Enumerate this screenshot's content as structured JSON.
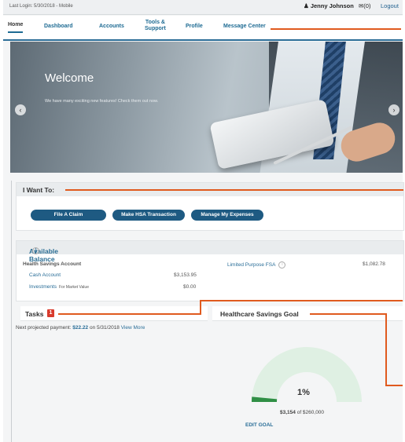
{
  "topbar": {
    "last_login": "Last Login: 5/30/2018 - Mobile",
    "user": "Jenny Johnson",
    "messages": "(0)",
    "logout": "Logout"
  },
  "nav": {
    "tabs": [
      "Home",
      "Dashboard",
      "Accounts",
      "Tools & Support",
      "Profile",
      "Message Center"
    ],
    "tools_line1": "Tools &",
    "tools_line2": "Support"
  },
  "hero": {
    "title": "Welcome",
    "subtitle": "We have many exciting new features! Check them out now."
  },
  "i_want_to": {
    "heading": "I Want To:",
    "buttons": [
      "File A Claim",
      "Make HSA Transaction",
      "Manage My Expenses"
    ]
  },
  "available_balance": {
    "heading": "Available Balance",
    "hsa_label": "Health Savings Account",
    "cash_label": "Cash Account",
    "cash_value": "$3,153.95",
    "investments_label": "Investments",
    "investments_note": "For Market Value",
    "investments_value": "$0.00",
    "fsa_label": "Limited Purpose FSA",
    "fsa_value": "$1,082.78"
  },
  "tasks": {
    "heading": "Tasks",
    "count": "1",
    "next_text": "Next projected payment:",
    "amount": "$22.22",
    "on_text": "on 5/31/2018",
    "view_more": "View More"
  },
  "savings_goal": {
    "heading": "Healthcare Savings Goal",
    "percent": "1%",
    "progress": 0.01,
    "amount": "$3,154",
    "of_text": "of $260,000",
    "edit": "EDIT GOAL"
  },
  "colors": {
    "accent": "#1e5a82",
    "callout": "#e05a1e",
    "gauge": "#dff0e3",
    "badge": "#d83b2d"
  },
  "icons": [
    "person-icon",
    "mail-icon",
    "info-icon",
    "chevron-left-icon",
    "chevron-right-icon"
  ]
}
